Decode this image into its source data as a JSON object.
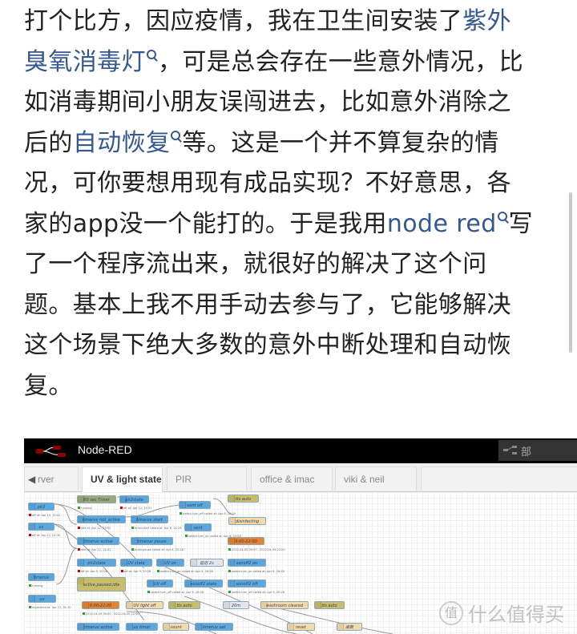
{
  "article": {
    "lines": [
      [
        {
          "text": "打个比方，因应疫情，我在卫生间安装了"
        },
        {
          "text": "紫外",
          "link": true
        }
      ],
      [
        {
          "text": "臭氧消毒灯",
          "link": true,
          "icon": true
        },
        {
          "text": "，可是总会存在一些意外情况，比"
        }
      ],
      [
        {
          "text": "如消毒期间小朋友误闯进去，比如意外消除之"
        }
      ],
      [
        {
          "text": "后的"
        },
        {
          "text": "自动恢复",
          "link": true,
          "icon": true
        },
        {
          "text": "等。这是一个并不算复杂的情"
        }
      ],
      [
        {
          "text": "况，可你要想用现有成品实现？不好意思，各"
        }
      ],
      [
        {
          "text": "家的app没一个能打的。于是我用"
        },
        {
          "text": "node red",
          "link": true,
          "icon": true
        },
        {
          "text": "写"
        }
      ],
      [
        {
          "text": "了一个程序流出来，就很好的解决了这个问"
        }
      ],
      [
        {
          "text": "题。基本上我不用手动去参与了，它能够解决"
        }
      ],
      [
        {
          "text": "这个场景下绝大多数的意外中断处理和自动恢"
        }
      ],
      [
        {
          "text": "复。"
        }
      ]
    ],
    "link_color": "#35588f",
    "link_icon": "search-icon"
  },
  "nodered": {
    "title": "Node-RED",
    "deploy_label": "部",
    "tabs": [
      "rver",
      "UV & light state",
      "PIR",
      "office & imac",
      "viki & neil"
    ],
    "active_tab": 1,
    "colors": {
      "blue": "#5ba7e0",
      "olive": "#c9bd6a",
      "beige": "#f6d9ab",
      "orange": "#e8822e",
      "grey": "#e4e4ec",
      "timer": "#a0a878"
    },
    "nodes": [
      {
        "label": "pir2",
        "type": "blue",
        "status": "off at: Apr 12, 15:41",
        "sc": "red"
      },
      {
        "label": "60 sec Timer",
        "type": "timer",
        "status": "running",
        "sc": "green"
      },
      {
        "label": "pir2state",
        "type": "blue",
        "status": "off at: Apr 12, 15:31",
        "sc": "red"
      },
      {
        "label": "vent off",
        "type": "blue",
        "status": "switch.turn_off called at: Apr 8, 20:29",
        "sc": "green"
      },
      {
        "label": "tts auto",
        "type": "olive"
      },
      {
        "label": "uv",
        "type": "blue",
        "status": "off at: Apr 12, 01:30",
        "sc": "red"
      },
      {
        "label": "timeruv not_active",
        "type": "blue",
        "status": "idle at: Apr 12, 15:52",
        "sc": "red"
      },
      {
        "label": "timeruv start",
        "type": "blue",
        "status": "timer.start called at: Apr 8, 20:29",
        "sc": "green"
      },
      {
        "label": "disinfecting",
        "type": "beige"
      },
      {
        "label": "vent",
        "type": "blue",
        "status": "switch.turn_on called at: Apr 8, 20:28",
        "sc": "green"
      },
      {
        "label": "timeruv active",
        "type": "blue",
        "status": "idle at: Apr 12, 15:41",
        "sc": "red"
      },
      {
        "label": "timeruv pause",
        "type": "blue",
        "status": "timer.pause called at: Apr 8, 20:28",
        "sc": "green"
      },
      {
        "label": "9:00-22:00",
        "type": "orange",
        "status": "2022-04-09 09:00 - 2022-04-09 22:00",
        "sc": "green"
      },
      {
        "label": "pir2state",
        "type": "blue",
        "status": "off at: Apr 9, 20:28",
        "sc": "red"
      },
      {
        "label": "UV state",
        "type": "blue",
        "status": "off at: Apr 9, 20:28",
        "sc": "red"
      },
      {
        "label": "UV on",
        "type": "blue",
        "status": "switch.turn_on called at: Apr 9, 20:28",
        "sc": "green"
      },
      {
        "label": "延迟 2s",
        "type": "grey"
      },
      {
        "label": "sonoff2 on",
        "type": "blue",
        "status": "switch.turn_on called at: Apr 9, 20:28",
        "sc": "green"
      },
      {
        "label": "timeruv",
        "type": "blue",
        "status": "running",
        "sc": "green"
      },
      {
        "label": "active,paused,idle",
        "type": "olive"
      },
      {
        "label": "UV off",
        "type": "blue",
        "status": "switch.turn_off called at: Apr 9, 20:28",
        "sc": "green"
      },
      {
        "label": "sonoff2 state",
        "type": "blue"
      },
      {
        "label": "sonoff2 off",
        "type": "blue",
        "status": "switch.turn_off called at: Apr 9, 20:28",
        "sc": "green"
      },
      {
        "label": "uv",
        "type": "blue",
        "status": "registered at: Apr 12, 01:30",
        "sc": "green"
      },
      {
        "label": "9:00-22:00",
        "type": "orange",
        "status": "2022-04-09 09:00 - 2022-04-09 22:00",
        "sc": "green"
      },
      {
        "label": "UV light off",
        "type": "beige"
      },
      {
        "label": "tts auto",
        "type": "olive"
      },
      {
        "label": "20m",
        "type": "grey"
      },
      {
        "label": "washroom cleared",
        "type": "beige"
      },
      {
        "label": "tts auto",
        "type": "olive"
      },
      {
        "label": "timeruv active",
        "type": "blue"
      },
      {
        "label": "uv timer",
        "type": "blue"
      },
      {
        "label": "count",
        "type": "beige"
      },
      {
        "label": "timeruv set",
        "type": "blue"
      },
      {
        "label": "reset",
        "type": "beige"
      },
      {
        "label": "函数",
        "type": "beige"
      }
    ]
  },
  "watermark": {
    "logo": "值",
    "text": "什么值得买"
  }
}
